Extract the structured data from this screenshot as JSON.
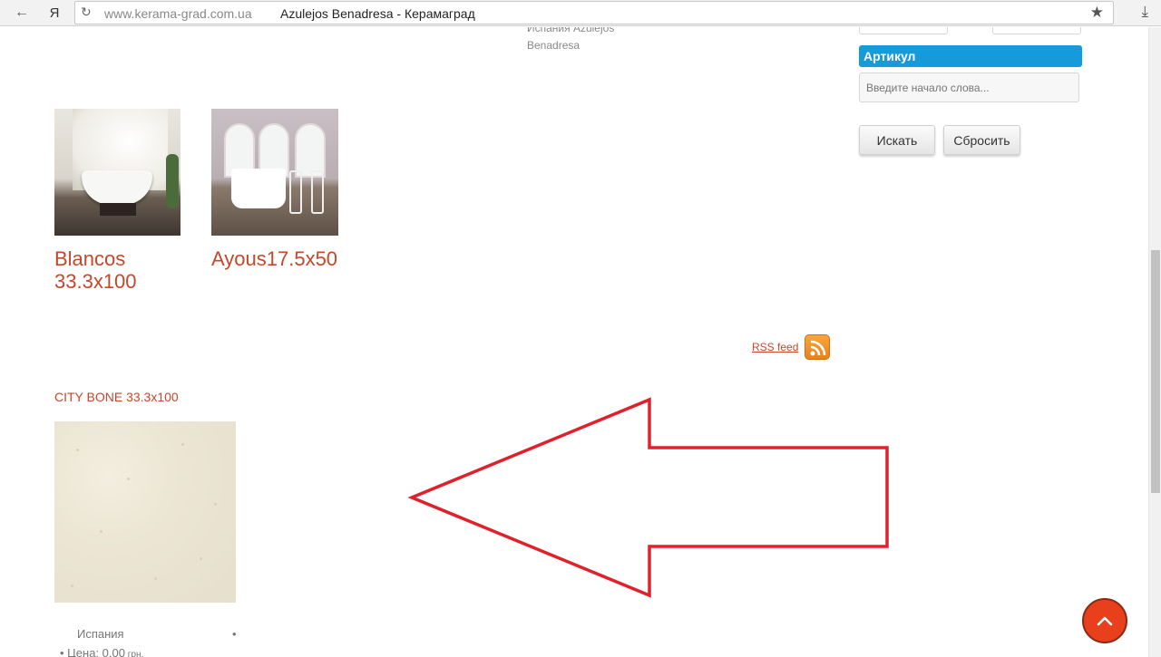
{
  "browser": {
    "back_icon": "←",
    "ya_icon": "Я",
    "reload_icon": "↻",
    "url": "www.kerama-grad.com.ua",
    "tab_title": "Azulejos Benadresa - Керамаград",
    "star_icon": "★",
    "download_icon": "⤓"
  },
  "breadcrumb": {
    "text": "Испания Azulejos Benadresa"
  },
  "products": [
    {
      "name": "Blancos 33.3x100"
    },
    {
      "name": "Ayous17.5x50"
    }
  ],
  "rss": {
    "label": "RSS feed"
  },
  "featured": {
    "title": "CITY BONE 33.3x100",
    "country": "Испания",
    "bullet": "•",
    "price_label": "• Цена: 0.00",
    "currency": " грн."
  },
  "filter": {
    "artikul_header": "Артикул",
    "artikul_placeholder": "Введите начало слова...",
    "search_label": "Искать",
    "reset_label": "Сбросить"
  },
  "colors": {
    "accent": "#c8462a",
    "header_blue": "#159bd9",
    "annotation": "#e0202a",
    "scroll_top": "#e8401c"
  }
}
